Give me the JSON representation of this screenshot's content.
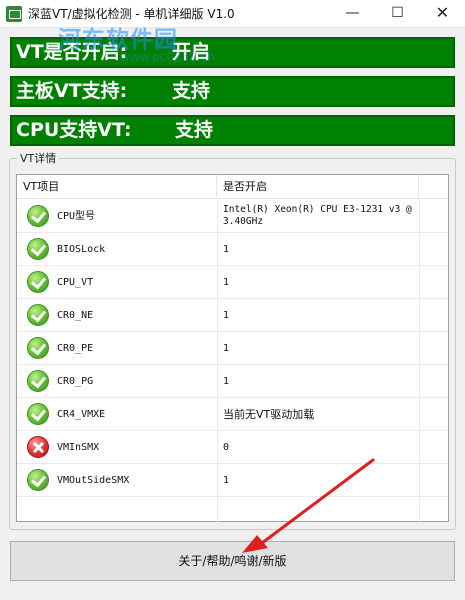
{
  "window": {
    "title": "深蓝VT/虚拟化检测 - 单机详细版 V1.0",
    "minimize": "—",
    "maximize": "☐",
    "close": "✕"
  },
  "watermark": {
    "text": "河东软件园",
    "sub": "www.pc0359.cn"
  },
  "banners": [
    {
      "label": "VT是否开启:",
      "value": "开启"
    },
    {
      "label": "主板VT支持:",
      "value": "支持"
    },
    {
      "label": "CPU支持VT:",
      "value": "支持"
    }
  ],
  "group": {
    "title": "VT详情"
  },
  "table": {
    "columns": [
      "VT项目",
      "是否开启",
      ""
    ],
    "rows": [
      {
        "status": "ok",
        "name": "CPU型号",
        "value": "Intel(R) Xeon(R) CPU E3-1231 v3 @ 3.40GHz"
      },
      {
        "status": "ok",
        "name": "BIOSLock",
        "value": "1"
      },
      {
        "status": "ok",
        "name": "CPU_VT",
        "value": "1"
      },
      {
        "status": "ok",
        "name": "CR0_NE",
        "value": "1"
      },
      {
        "status": "ok",
        "name": "CR0_PE",
        "value": "1"
      },
      {
        "status": "ok",
        "name": "CR0_PG",
        "value": "1"
      },
      {
        "status": "ok",
        "name": "CR4_VMXE",
        "value": "当前无VT驱动加载"
      },
      {
        "status": "error",
        "name": "VMInSMX",
        "value": "0"
      },
      {
        "status": "ok",
        "name": "VMOutSideSMX",
        "value": "1"
      }
    ]
  },
  "footer": {
    "about_label": "关于/帮助/鸣谢/新版"
  },
  "colors": {
    "banner_green": "#008000",
    "ok_green": "#6cc43a",
    "error_red": "#e23a3a",
    "annotation_arrow": "#e02020"
  }
}
